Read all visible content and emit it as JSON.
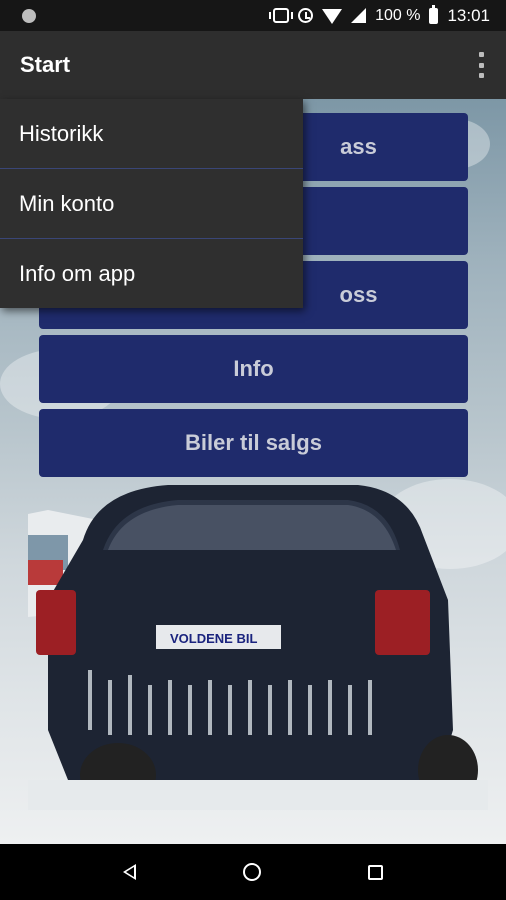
{
  "status_bar": {
    "battery": "100 %",
    "time": "13:01"
  },
  "toolbar": {
    "title": "Start"
  },
  "buttons": [
    {
      "label": "ass"
    },
    {
      "label": ""
    },
    {
      "label": "oss"
    },
    {
      "label": "Info"
    },
    {
      "label": "Biler til salgs"
    }
  ],
  "menu": {
    "items": [
      {
        "label": "Historikk"
      },
      {
        "label": "Min konto"
      },
      {
        "label": "Info om app"
      }
    ]
  },
  "car": {
    "plate_text_part1": "V",
    "plate_text_part2": "OLDENE",
    "plate_text_part3": "BIL"
  },
  "colors": {
    "button_bg": "#1f2b6c",
    "toolbar_bg": "#2e2e2e",
    "menu_bg": "#2f2f2f"
  }
}
